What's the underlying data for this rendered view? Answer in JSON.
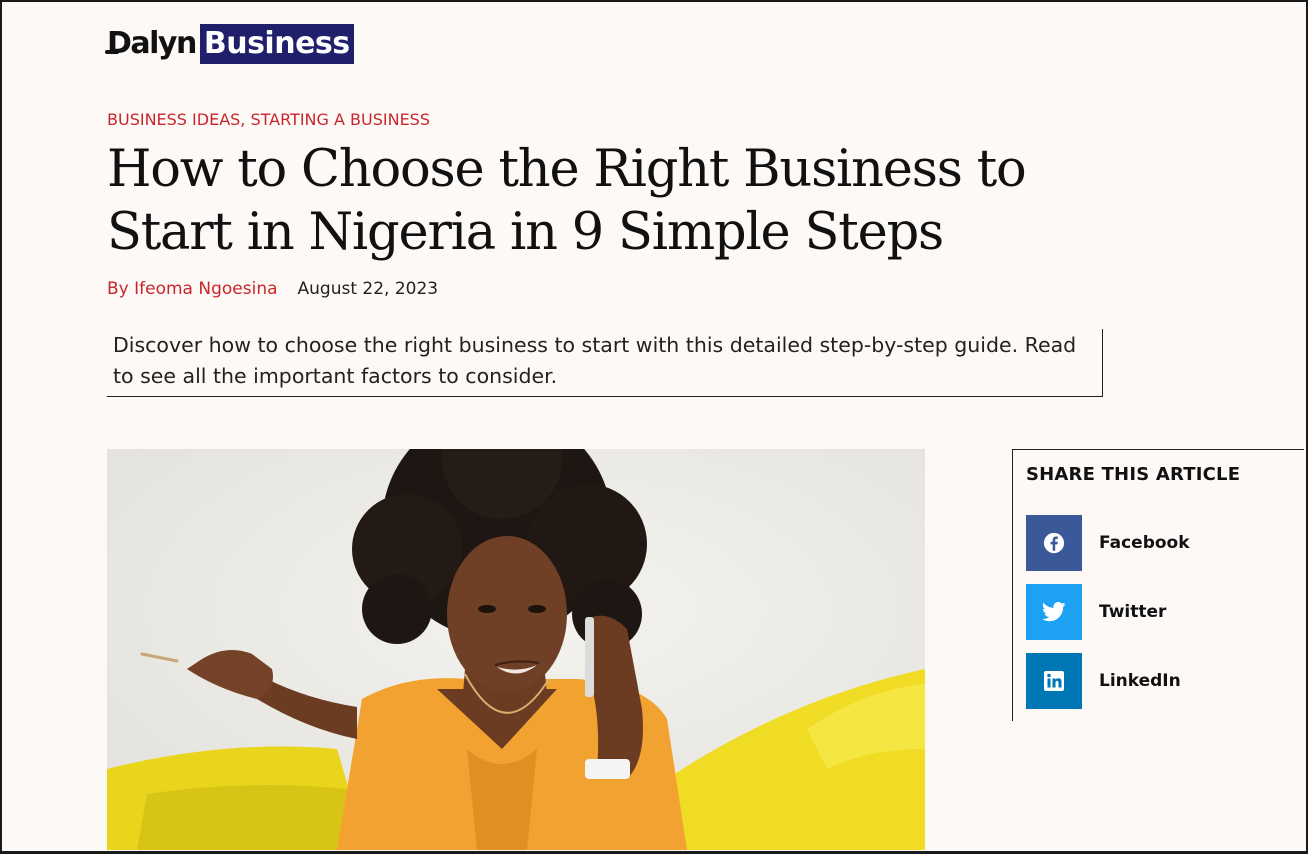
{
  "brand": {
    "logo_word": "Dalyn",
    "logo_box": "Business",
    "box_color": "#1f1f6b"
  },
  "article": {
    "categories": [
      "BUSINESS IDEAS",
      "STARTING A BUSINESS"
    ],
    "category_separator": ", ",
    "title_line1": "How to Choose the Right Business to",
    "title_line2": "Start in Nigeria in 9 Simple Steps",
    "author": "By Ifeoma Ngoesina",
    "date": "August 22, 2023",
    "summary": "Discover how to choose the right business to start with this detailed step-by-step guide. Read to see all the important factors to consider."
  },
  "share": {
    "title": "SHARE THIS ARTICLE",
    "items": [
      {
        "label": "Facebook",
        "icon": "facebook-icon",
        "color": "#3b5998"
      },
      {
        "label": "Twitter",
        "icon": "twitter-icon",
        "color": "#1da1f2"
      },
      {
        "label": "LinkedIn",
        "icon": "linkedin-icon",
        "color": "#0077b5"
      }
    ]
  },
  "colors": {
    "accent": "#c8262c",
    "background": "#fdf9f7",
    "text": "#111111"
  }
}
